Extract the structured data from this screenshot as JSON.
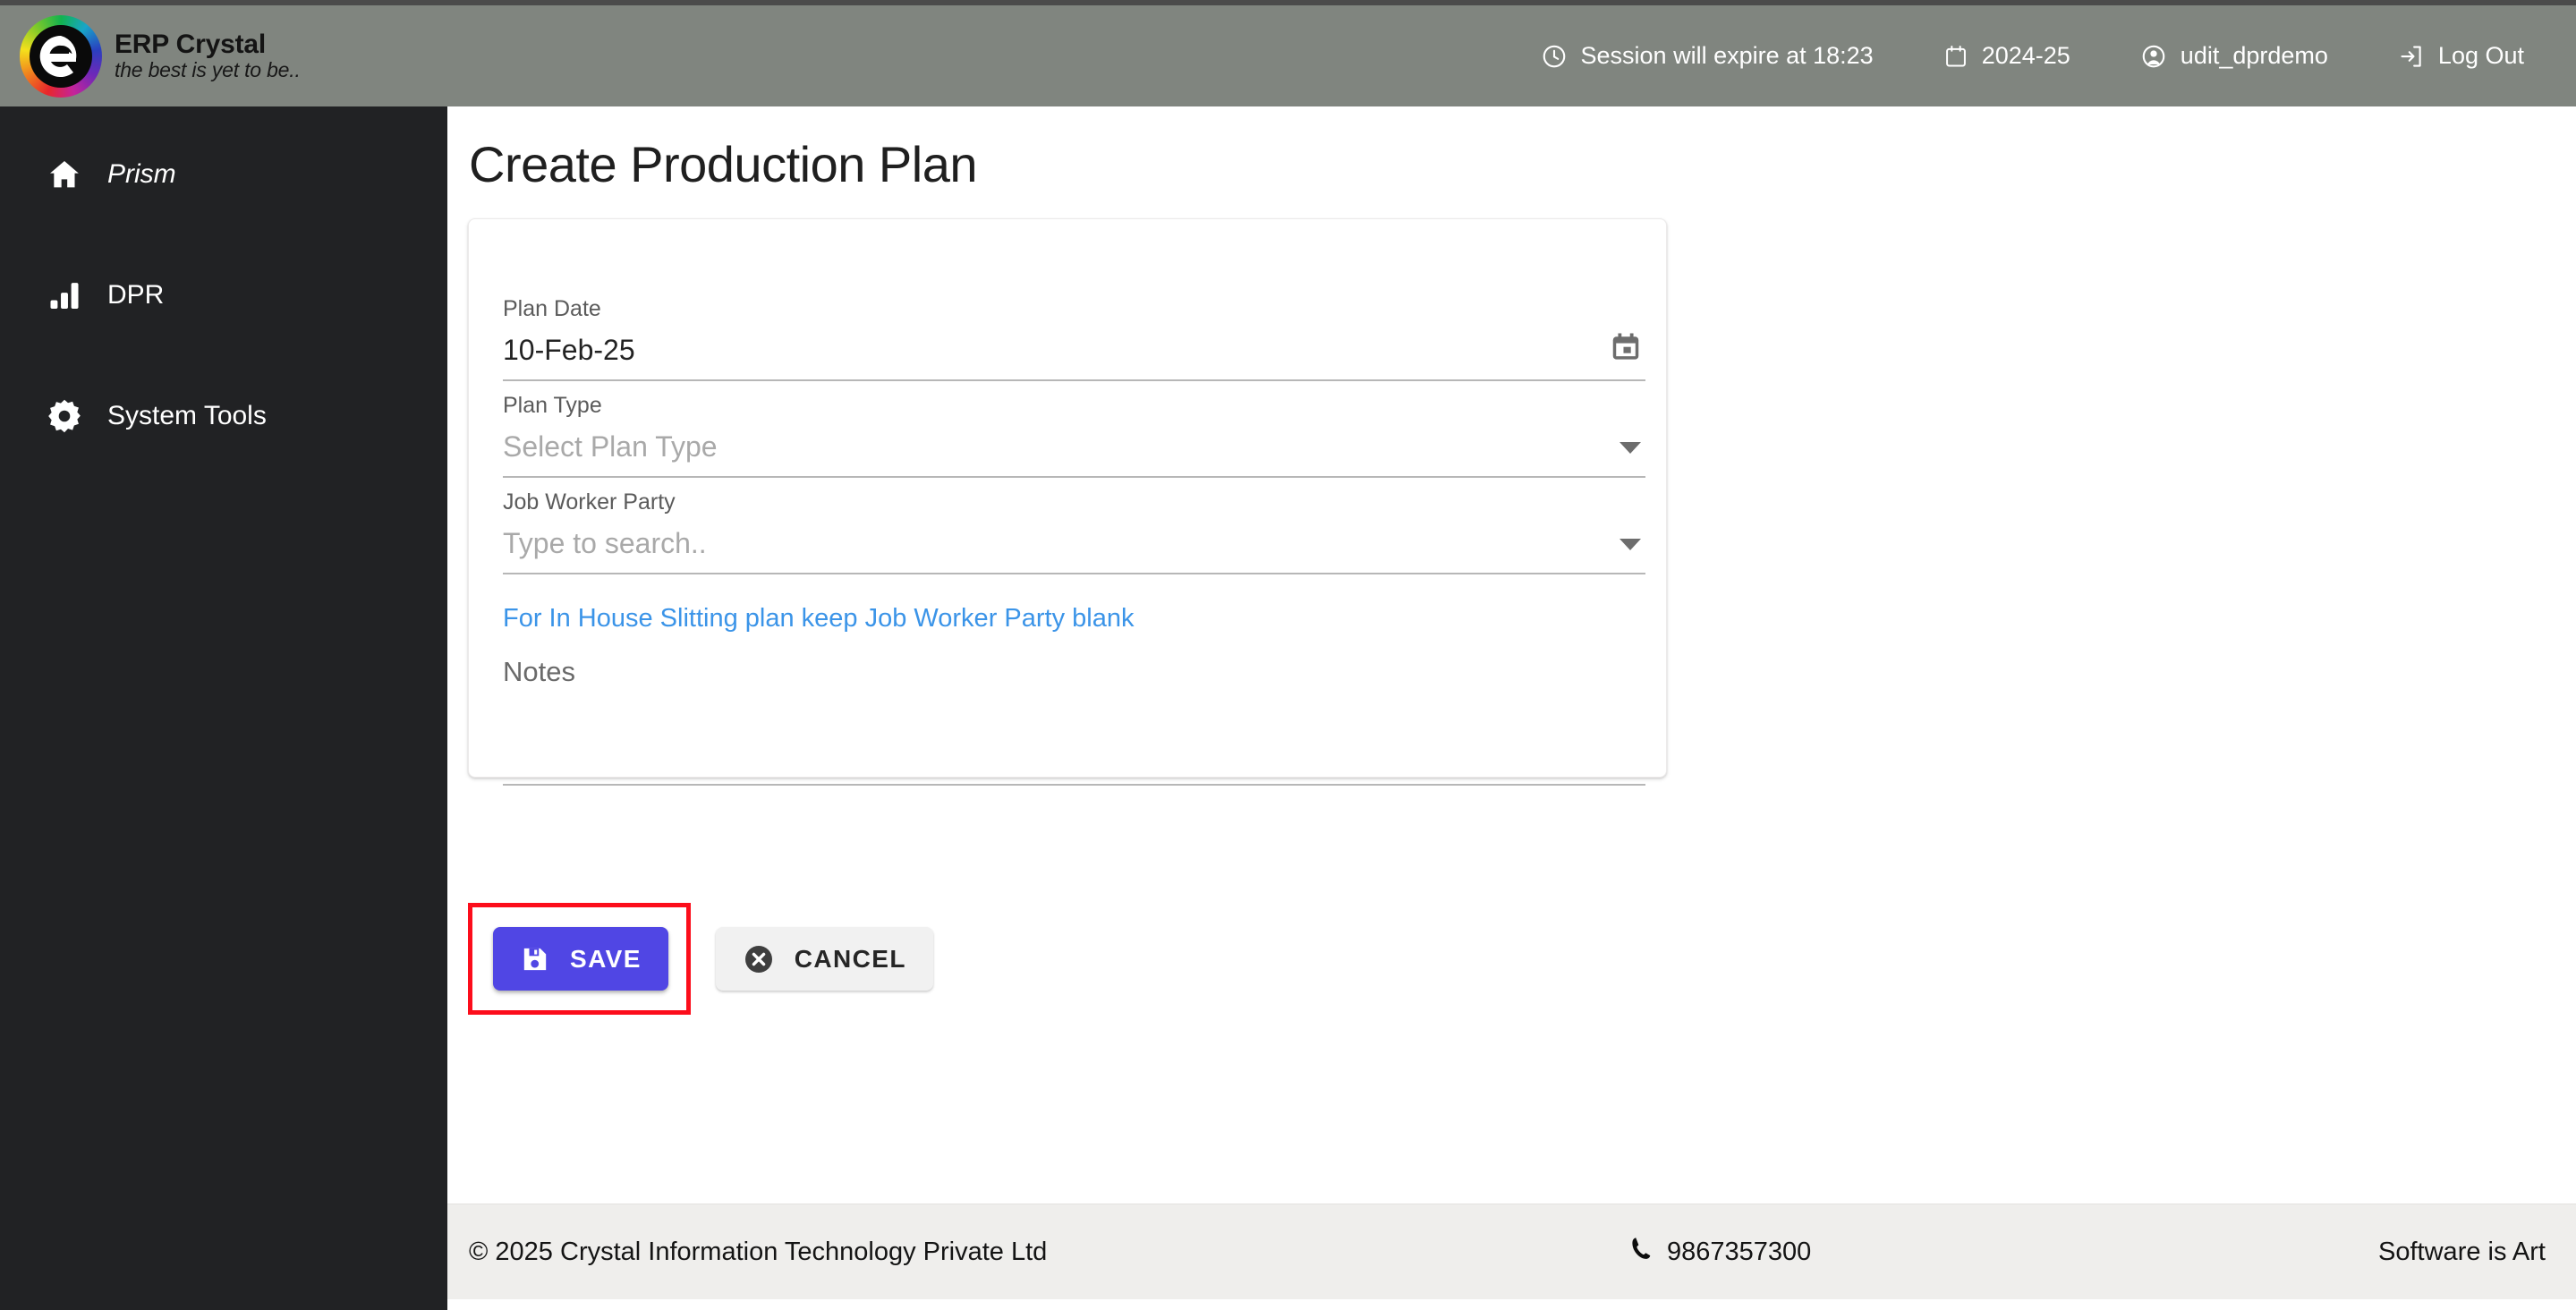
{
  "brand": {
    "title": "ERP Crystal",
    "tagline": "the best is yet to be..",
    "logo_icon": "erp-crystal-logo"
  },
  "header": {
    "session": {
      "icon": "clock-icon",
      "label": "Session will expire at 18:23"
    },
    "fiscal_year": {
      "icon": "calendar-icon",
      "label": "2024-25"
    },
    "user": {
      "icon": "user-circle-icon",
      "label": "udit_dprdemo"
    },
    "logout": {
      "icon": "logout-icon",
      "label": "Log Out"
    },
    "background_color": "#80857f"
  },
  "sidebar": {
    "background_color": "#212224",
    "items": [
      {
        "icon": "home-icon",
        "label": "Prism",
        "italic": true
      },
      {
        "icon": "bar-chart-icon",
        "label": "DPR",
        "italic": false
      },
      {
        "icon": "gear-icon",
        "label": "System Tools",
        "italic": false
      }
    ]
  },
  "main": {
    "page_title": "Create Production Plan",
    "form": {
      "plan_date": {
        "label": "Plan Date",
        "value": "10-Feb-25",
        "affix_icon": "calendar-icon"
      },
      "plan_type": {
        "label": "Plan Type",
        "placeholder": "Select Plan Type",
        "value": "",
        "affix_icon": "chevron-down-icon"
      },
      "job_worker_party": {
        "label": "Job Worker Party",
        "placeholder": "Type to search..",
        "value": "",
        "affix_icon": "chevron-down-icon"
      },
      "hint": {
        "text": "For In House Slitting plan keep Job Worker Party blank",
        "color": "#3b94e8"
      },
      "notes": {
        "label": "Notes",
        "placeholder": "Notes",
        "value": ""
      }
    },
    "actions": {
      "save": {
        "label": "SAVE",
        "icon": "save-floppy-icon",
        "color": "#5046e4",
        "highlight_color": "#fc0d1b"
      },
      "cancel": {
        "label": "CANCEL",
        "icon": "close-circle-icon",
        "color": "#f1f1f1"
      }
    }
  },
  "footer": {
    "copyright": "© 2025 Crystal Information Technology Private Ltd",
    "phone": {
      "icon": "phone-icon",
      "label": "9867357300"
    },
    "tagline": "Software is Art"
  }
}
